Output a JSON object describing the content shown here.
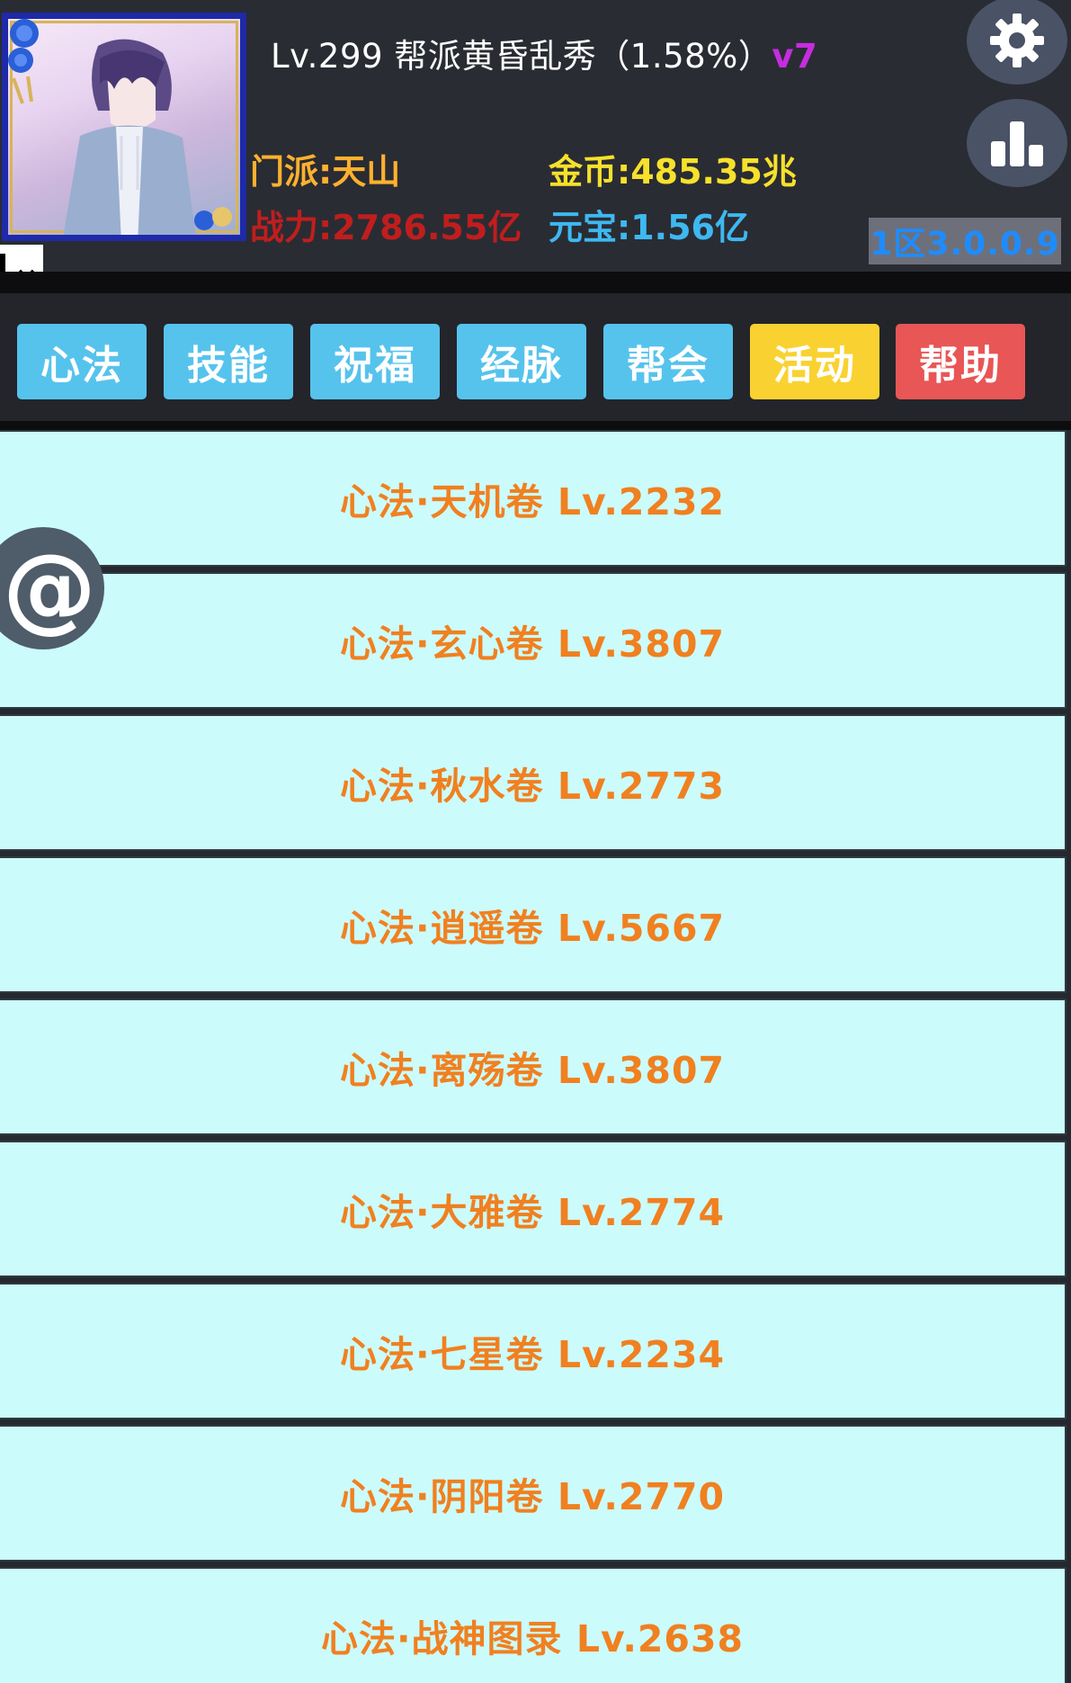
{
  "header": {
    "level_text": "Lv.299 帮派黄昏乱秀（1.58%）",
    "vip_text": "v7",
    "sect": "门派:天山",
    "gold": "金币:485.35兆",
    "power": "战力:2786.55亿",
    "ingot": "元宝:1.56亿",
    "server": "1区3.0.0.9",
    "close_label": "×"
  },
  "tabs": [
    {
      "label": "心法",
      "color": "#56c3ec"
    },
    {
      "label": "技能",
      "color": "#56c3ec"
    },
    {
      "label": "祝福",
      "color": "#56c3ec"
    },
    {
      "label": "经脉",
      "color": "#56c3ec"
    },
    {
      "label": "帮会",
      "color": "#56c3ec"
    },
    {
      "label": "活动",
      "color": "#f9d231"
    },
    {
      "label": "帮助",
      "color": "#e85656"
    }
  ],
  "floating": {
    "at_label": "@"
  },
  "list": {
    "items": [
      {
        "label": "心法·天机卷 Lv.2232"
      },
      {
        "label": "心法·玄心卷 Lv.3807"
      },
      {
        "label": "心法·秋水卷 Lv.2773"
      },
      {
        "label": "心法·逍遥卷 Lv.5667"
      },
      {
        "label": "心法·离殇卷 Lv.3807"
      },
      {
        "label": "心法·大雅卷 Lv.2774"
      },
      {
        "label": "心法·七星卷 Lv.2234"
      },
      {
        "label": "心法·阴阳卷 Lv.2770"
      },
      {
        "label": "心法·战神图录 Lv.2638"
      }
    ]
  },
  "colors": {
    "background": "#26282f",
    "list_item_bg": "#ccfbfb",
    "list_item_text": "#f08020",
    "gold": "#f6e12c",
    "sect": "#ffb12e",
    "power": "#c01e1e",
    "ingot": "#3eb8f0",
    "vip": "#c62de0"
  }
}
